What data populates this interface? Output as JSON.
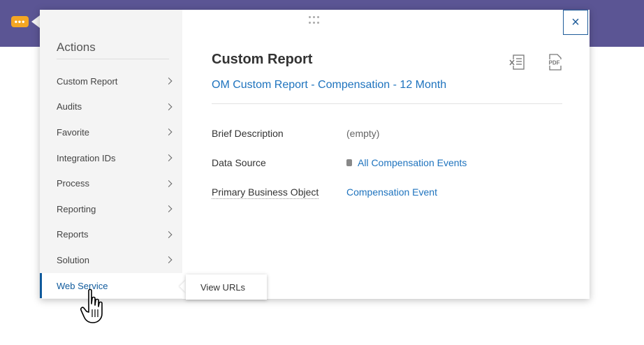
{
  "header": {
    "menu_button_icon": "ellipsis-icon",
    "bar_color": "#5b5594",
    "button_color": "#f5a623"
  },
  "sidebar": {
    "title": "Actions",
    "items": [
      {
        "label": "Custom Report",
        "has_submenu": true
      },
      {
        "label": "Audits",
        "has_submenu": true
      },
      {
        "label": "Favorite",
        "has_submenu": true
      },
      {
        "label": "Integration IDs",
        "has_submenu": true
      },
      {
        "label": "Process",
        "has_submenu": true
      },
      {
        "label": "Reporting",
        "has_submenu": true
      },
      {
        "label": "Reports",
        "has_submenu": true
      },
      {
        "label": "Solution",
        "has_submenu": true
      },
      {
        "label": "Web Service",
        "has_submenu": false,
        "active": true
      }
    ]
  },
  "submenu": {
    "items": [
      "View URLs"
    ]
  },
  "main": {
    "title": "Custom Report",
    "subtitle": "OM Custom Report - Compensation - 12 Month",
    "close_label": "×",
    "export_icons": [
      "excel-icon",
      "pdf-icon"
    ],
    "pdf_text": "PDF",
    "fields": [
      {
        "label": "Brief Description",
        "value": "(empty)"
      },
      {
        "label": "Data Source",
        "value": "All Compensation Events"
      },
      {
        "label": "Primary Business Object",
        "value": "Compensation Event"
      }
    ]
  },
  "colors": {
    "link": "#1e73be",
    "active": "#0f5a9c"
  }
}
